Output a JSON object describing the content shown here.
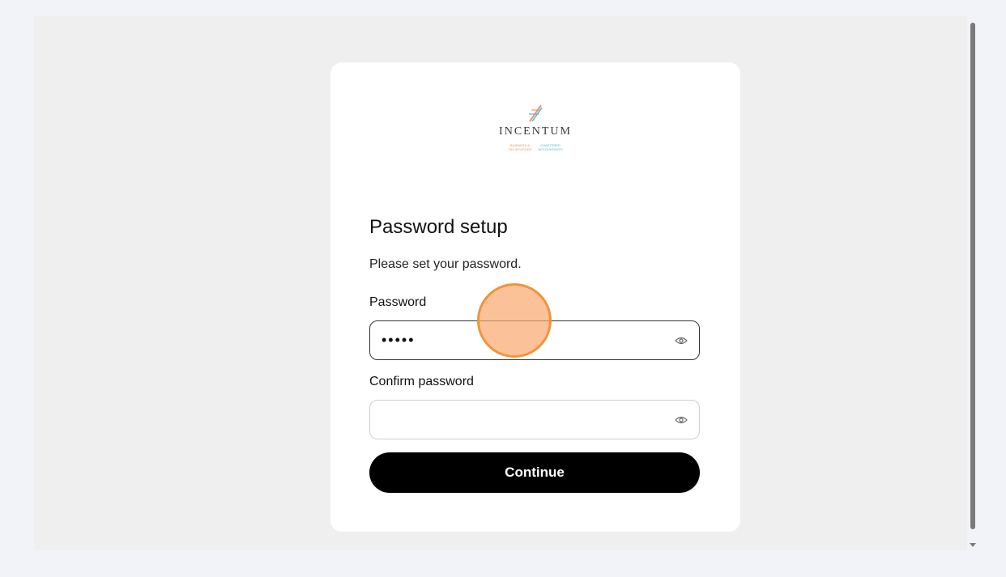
{
  "logo": {
    "name": "INCENTUM",
    "tagline_left": [
      "BUSINESS &",
      "TAX ADVISORS"
    ],
    "tagline_right": [
      "CHARTERED",
      "ACCOUNTANTS"
    ]
  },
  "form": {
    "title": "Password setup",
    "subtitle": "Please set your password.",
    "password_label": "Password",
    "password_value": "•••••",
    "confirm_label": "Confirm password",
    "confirm_value": "",
    "submit_label": "Continue"
  },
  "colors": {
    "button": "#000000",
    "card": "#ffffff",
    "background": "#efefef",
    "click_marker": "#f0943c"
  },
  "icons": [
    "eye-icon"
  ]
}
